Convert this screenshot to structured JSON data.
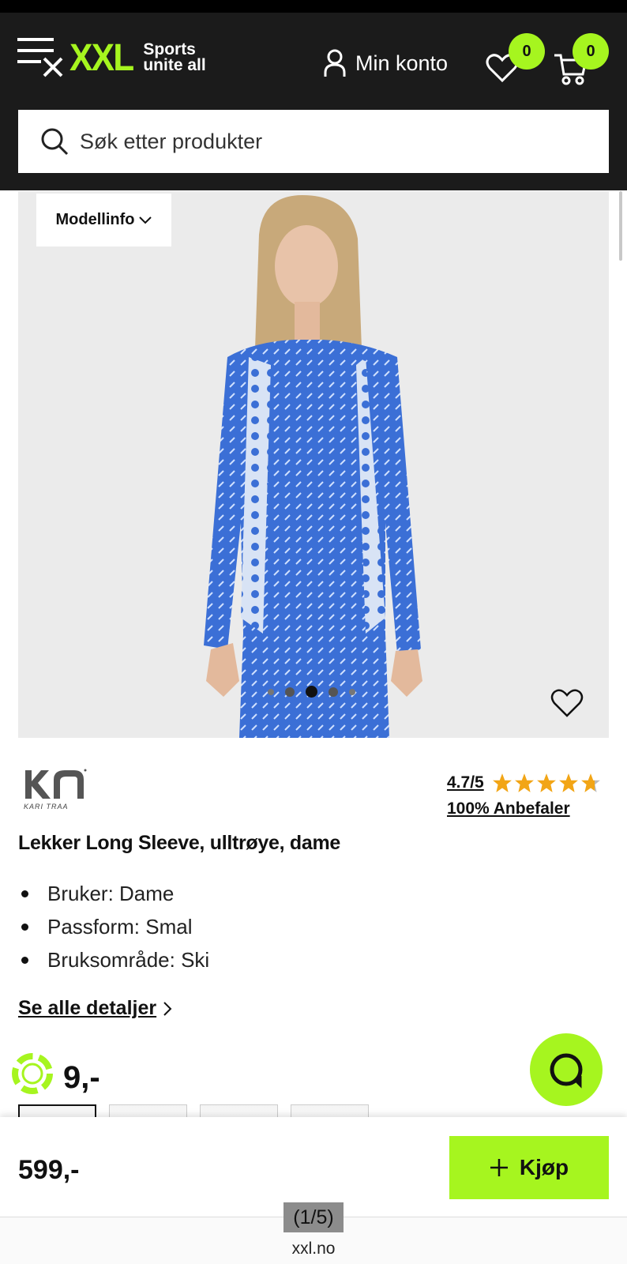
{
  "header": {
    "logo_text": "XXL",
    "logo_tagline_1": "Sports",
    "logo_tagline_2": "unite all",
    "account_label": "Min konto",
    "wishlist_count": "0",
    "cart_count": "0",
    "brand_color": "#a6f51f"
  },
  "search": {
    "placeholder": "Søk etter produkter"
  },
  "gallery": {
    "model_info_label": "Modellinfo",
    "image_count": 5,
    "active_image_index": 3
  },
  "product": {
    "brand_caption": "KARI TRAA",
    "rating_text": "4.7/5",
    "rating_value": 4.7,
    "rating_max": 5,
    "recommend_text": "100% Anbefaler",
    "title": "Lekker Long Sleeve, ulltrøye, dame",
    "features": [
      "Bruker: Dame",
      "Passform: Smal",
      "Bruksområde: Ski"
    ],
    "details_link": "Se alle detaljer",
    "price_partial": "9,-"
  },
  "buybar": {
    "price": "599,-",
    "buy_label": "Kjøp"
  },
  "browser": {
    "page_counter": "(1/5)",
    "url": "xxl.no"
  }
}
